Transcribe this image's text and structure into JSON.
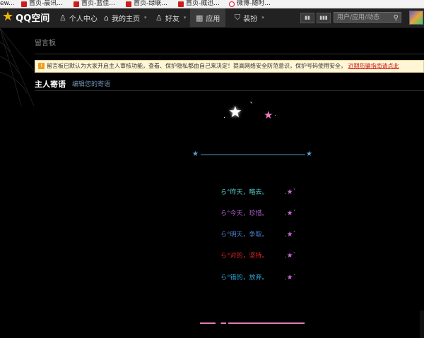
{
  "bookmarks": [
    {
      "label": "ew...",
      "icon": "none"
    },
    {
      "label": "首页-晨讯...",
      "icon": "red-square-icon"
    },
    {
      "label": "首页-蓝佳...",
      "icon": "red-square-icon"
    },
    {
      "label": "首页-绿联...",
      "icon": "red-square-icon"
    },
    {
      "label": "首页-威迅...",
      "icon": "red-square-icon"
    },
    {
      "label": "微博-随时...",
      "icon": "weibo-icon"
    }
  ],
  "nav": {
    "logo_text": "QQ空间",
    "items": [
      {
        "label": "个人中心",
        "icon": "person-icon"
      },
      {
        "label": "我的主页",
        "icon": "home-icon"
      },
      {
        "label": "好友",
        "icon": "friends-icon"
      },
      {
        "label": "应用",
        "icon": "apps-grid-icon"
      },
      {
        "label": "装扮",
        "icon": "shirt-icon"
      }
    ],
    "active_index": 3,
    "search_placeholder": "用户/应用/动态",
    "btn1": "▮▮",
    "btn2": "▮▮▮"
  },
  "page": {
    "title": "留言板",
    "notice_text": "留言板已默认为大家开启主人审核功能，查看、保护隐私都由自己来决定！提高网络安全防范意识，保护号码使用安全，",
    "notice_link": "近期防骗指南请点此",
    "section_title": "主人寄语",
    "section_edit": "编辑您的寄语"
  },
  "message": {
    "divider_star_left": "★",
    "divider_star_right": "★",
    "lines": [
      {
        "text": "ら°昨天，略去。",
        "star": ".★`"
      },
      {
        "text": "ら°今天，珍惜。",
        "star": ".★`"
      },
      {
        "text": "ら°明天，争取。",
        "star": ".★`"
      },
      {
        "text": "ら°对的，坚持。",
        "star": ".★`"
      },
      {
        "text": "ら°错的，放弃。",
        "star": ".★`"
      }
    ]
  },
  "colors": {
    "topnav_bg": "#222222",
    "accent_link": "#d21c1c",
    "notice_bg": "#fff6d5"
  }
}
